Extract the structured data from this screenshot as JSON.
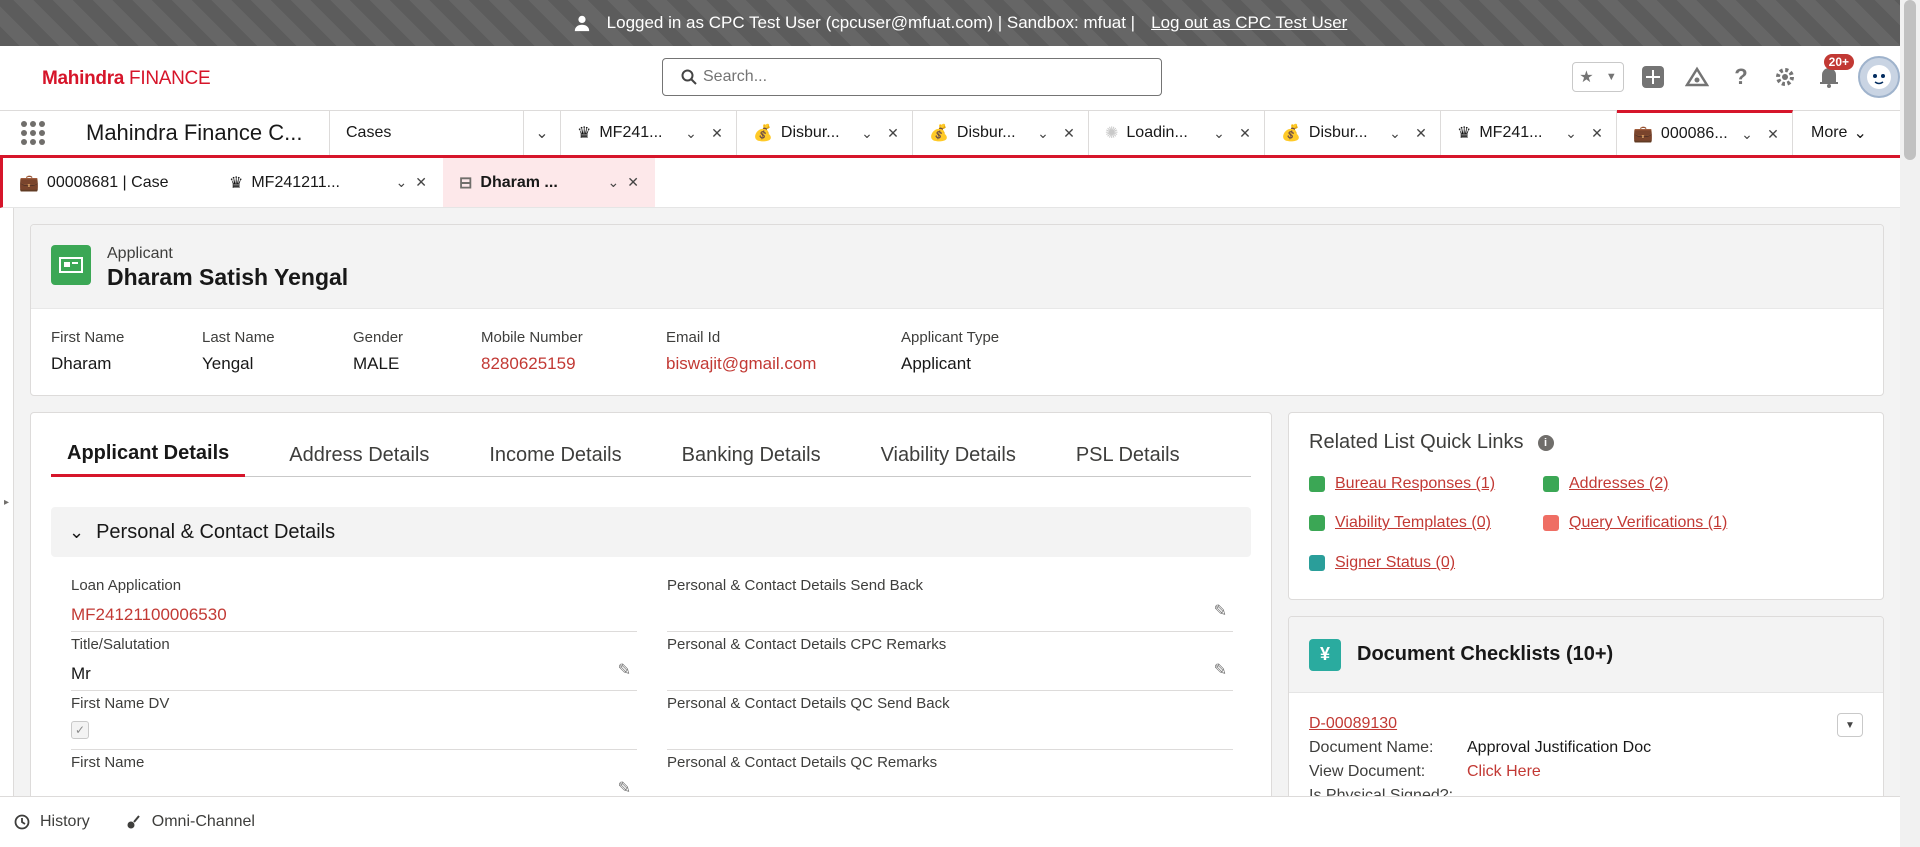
{
  "banner": {
    "logged_in_text": "Logged in as CPC Test User (cpcuser@mfuat.com) | Sandbox: mfuat |",
    "logout_link": "Log out as CPC Test User"
  },
  "header": {
    "logo_bold": "Mahindra",
    "logo_rest": "FINANCE",
    "search_placeholder": "Search...",
    "notification_count": "20+"
  },
  "nav": {
    "app_name": "Mahindra Finance C...",
    "object_tab": "Cases",
    "tabs": [
      {
        "label": "MF241...",
        "icon": "crown-icon"
      },
      {
        "label": "Disbur...",
        "icon": "money-bag-icon"
      },
      {
        "label": "Disbur...",
        "icon": "money-bag-icon"
      },
      {
        "label": "Loadin...",
        "icon": "loading-spinner-icon"
      },
      {
        "label": "Disbur...",
        "icon": "money-bag-icon"
      },
      {
        "label": "MF241...",
        "icon": "crown-icon"
      },
      {
        "label": "000086...",
        "icon": "briefcase-icon"
      }
    ],
    "more_label": "More"
  },
  "subtabs": [
    {
      "label": "00008681 | Case",
      "icon": "briefcase-icon"
    },
    {
      "label": "MF241211...",
      "icon": "crown-icon"
    },
    {
      "label": "Dharam ...",
      "icon": "applicant-icon"
    }
  ],
  "highlight": {
    "object_type": "Applicant",
    "title": "Dharam Satish Yengal",
    "fields": [
      {
        "label": "First Name",
        "value": "Dharam"
      },
      {
        "label": "Last Name",
        "value": "Yengal"
      },
      {
        "label": "Gender",
        "value": "MALE"
      },
      {
        "label": "Mobile Number",
        "value": "8280625159"
      },
      {
        "label": "Email Id",
        "value": "biswajit@gmail.com"
      },
      {
        "label": "Applicant Type",
        "value": "Applicant"
      }
    ]
  },
  "detail": {
    "tabs": [
      "Applicant Details",
      "Address Details",
      "Income Details",
      "Banking Details",
      "Viability Details",
      "PSL Details"
    ],
    "section_title": "Personal & Contact Details",
    "left_fields": [
      {
        "label": "Loan Application",
        "value": "MF24121100006530"
      },
      {
        "label": "Title/Salutation",
        "value": "Mr"
      },
      {
        "label": "First Name DV",
        "value": ""
      },
      {
        "label": "First Name",
        "value": ""
      }
    ],
    "right_fields": [
      {
        "label": "Personal & Contact Details Send Back",
        "value": ""
      },
      {
        "label": "Personal & Contact Details CPC Remarks",
        "value": ""
      },
      {
        "label": "Personal & Contact Details QC Send Back",
        "value": ""
      },
      {
        "label": "Personal & Contact Details QC Remarks",
        "value": ""
      }
    ]
  },
  "related": {
    "title": "Related List Quick Links",
    "links": [
      "Bureau Responses (1)",
      "Addresses (2)",
      "Viability Templates (0)",
      "Query Verifications (1)",
      "Signer Status (0)"
    ]
  },
  "checklist": {
    "title": "Document Checklists (10+)",
    "record": "D-00089130",
    "rows": [
      {
        "label": "Document Name:",
        "value": "Approval Justification Doc"
      },
      {
        "label": "View Document:",
        "value": "Click Here"
      },
      {
        "label": "Is Physical Signed?:",
        "value": ""
      }
    ]
  },
  "utility": {
    "history": "History",
    "omni": "Omni-Channel"
  },
  "colors": {
    "brand_red": "#d6152a",
    "link_red": "#c23934",
    "applicant_green": "#3ba755"
  }
}
